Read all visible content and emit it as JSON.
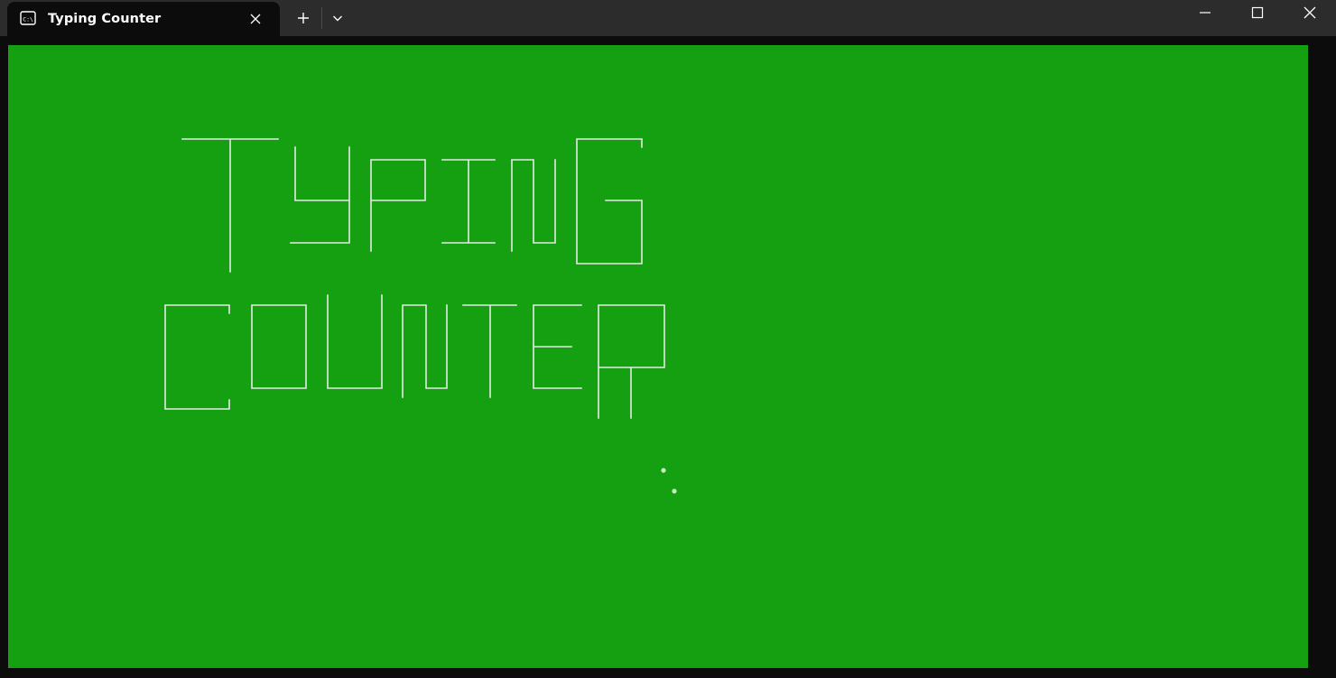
{
  "window": {
    "tab_title": "Typing Counter",
    "tab_icon": "terminal-icon",
    "controls": [
      "new-tab-icon",
      "chevron-down-icon",
      "minimize-icon",
      "maximize-icon",
      "close-icon"
    ]
  },
  "console": {
    "background_color": "#14a010",
    "banner_line_1": "TYPING",
    "banner_line_2": "COUNTER",
    "banner_color": "#e8e8e8",
    "loading_indicator": "dots"
  }
}
